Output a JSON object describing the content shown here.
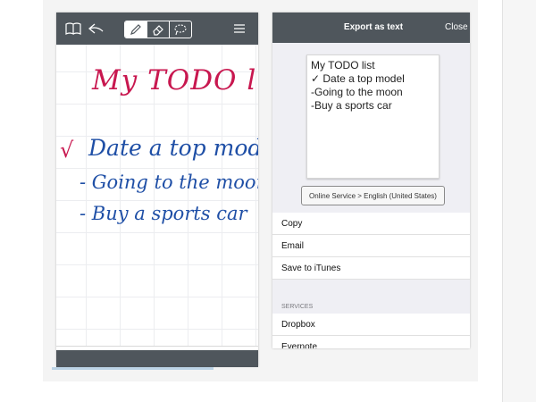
{
  "left_app": {
    "toolbar_icons": [
      "book-icon",
      "undo-icon",
      "pen-icon",
      "eraser-icon",
      "lasso-icon",
      "menu-icon"
    ],
    "handwriting": {
      "title": "My TODO list",
      "check": "√",
      "items": [
        "Date a top model",
        "- Going to the moon",
        "- Buy a sports car"
      ]
    },
    "colors": {
      "title": "#c8174f",
      "items": "#1f4fa6",
      "toolbar": "#4f565c"
    }
  },
  "export_sheet": {
    "title": "Export as text",
    "close_label": "Close",
    "note_lines": [
      "My TODO list",
      "✓ Date a top model",
      "-Going to the moon",
      "-Buy a sports car"
    ],
    "service_button": "Online Service > English (United States)",
    "actions": [
      "Copy",
      "Email",
      "Save to iTunes"
    ],
    "services_header": "SERVICES",
    "services": [
      "Dropbox",
      "Evernote"
    ]
  }
}
